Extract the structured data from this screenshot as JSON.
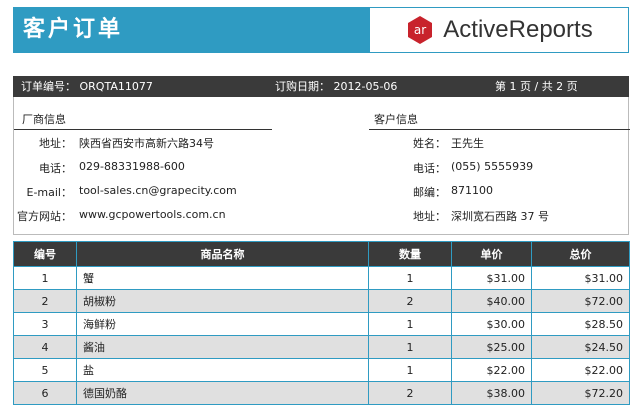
{
  "header": {
    "title": "客户订单",
    "logo_badge": "ar",
    "logo_text": "ActiveReports",
    "accent": "#2f9bc2"
  },
  "order_bar": {
    "order_no": "订单编号： ORQTA11077",
    "order_date": "订购日期： 2012-05-06",
    "page": "第 1 页 / 共 2 页"
  },
  "vendor": {
    "title": "厂商信息",
    "rows": [
      {
        "label": "地址：",
        "value": "陕西省西安市高新六路34号"
      },
      {
        "label": "电话：",
        "value": "029-88331988-600"
      },
      {
        "label": "E-mail：",
        "value": "tool-sales.cn@grapecity.com"
      },
      {
        "label": "官方网站：",
        "value": "www.gcpowertools.com.cn"
      }
    ]
  },
  "customer": {
    "title": "客户信息",
    "rows": [
      {
        "label": "姓名：",
        "value": "王先生"
      },
      {
        "label": "电话：",
        "value": "(055) 5555939"
      },
      {
        "label": "邮编：",
        "value": "871100"
      },
      {
        "label": "地址：",
        "value": "深圳宽石西路 37 号"
      }
    ]
  },
  "table": {
    "headers": [
      "编号",
      "商品名称",
      "数量",
      "单价",
      "总价"
    ],
    "rows": [
      [
        "1",
        "蟹",
        "1",
        "$31.00",
        "$31.00"
      ],
      [
        "2",
        "胡椒粉",
        "2",
        "$40.00",
        "$72.00"
      ],
      [
        "3",
        "海鲜粉",
        "1",
        "$30.00",
        "$28.50"
      ],
      [
        "4",
        "酱油",
        "1",
        "$25.00",
        "$24.50"
      ],
      [
        "5",
        "盐",
        "1",
        "$22.00",
        "$22.00"
      ],
      [
        "6",
        "德国奶酪",
        "2",
        "$38.00",
        "$72.20"
      ]
    ]
  }
}
